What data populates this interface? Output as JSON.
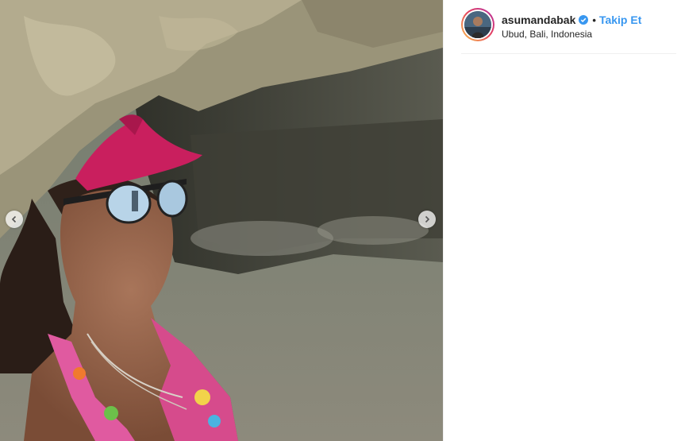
{
  "post": {
    "username": "asumandabak",
    "verified": true,
    "separator": "•",
    "follow_label": "Takip Et",
    "location": "Ubud, Bali, Indonesia"
  },
  "carousel": {
    "prev_icon": "chevron-left-icon",
    "next_icon": "chevron-right-icon"
  },
  "colors": {
    "follow_blue": "#3897f0",
    "verified_blue": "#3897f0",
    "text_dark": "#262626"
  }
}
